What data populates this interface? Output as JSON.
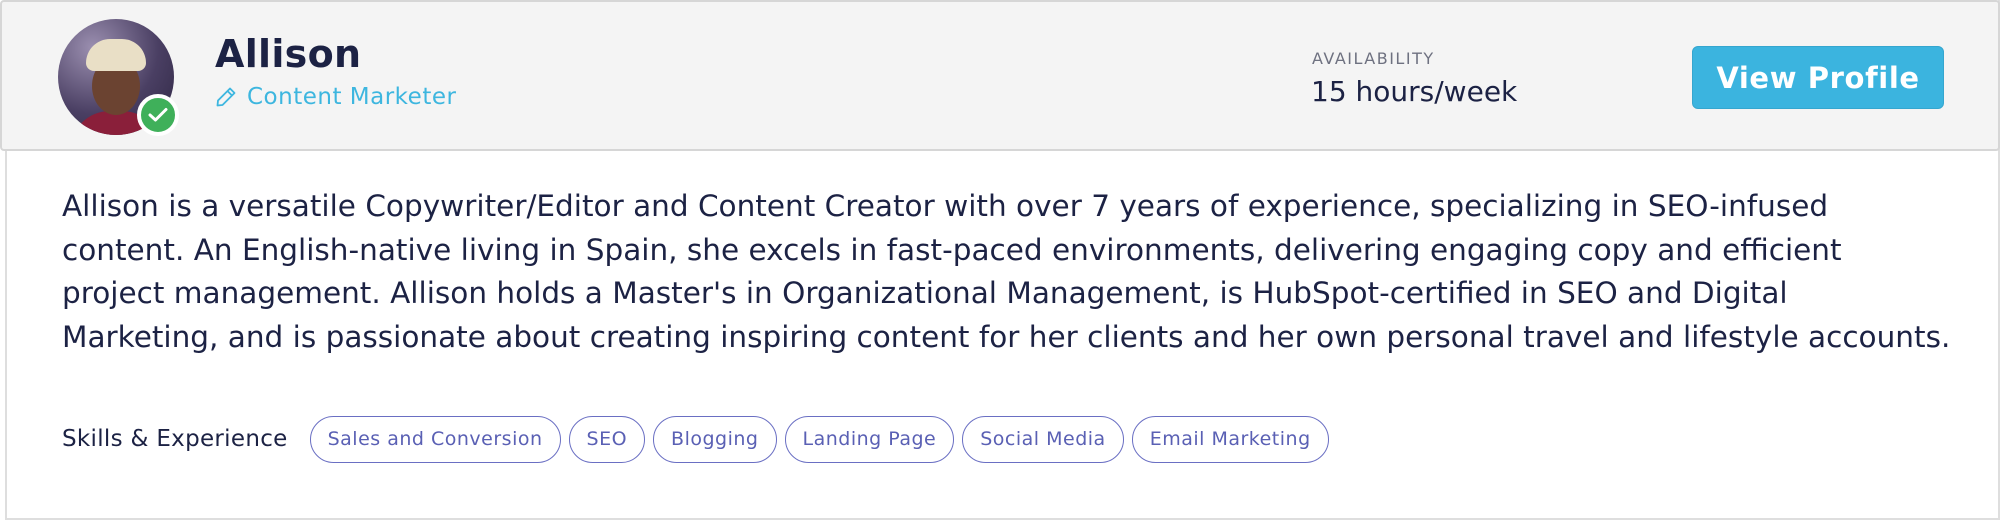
{
  "profile": {
    "name": "Allison",
    "role": "Content Marketer",
    "verified": true,
    "availability_label": "AVAILABILITY",
    "availability_value": "15 hours/week",
    "view_button_label": "View Profile"
  },
  "bio": "Allison is a versatile Copywriter/Editor and Content Creator with over 7 years of experience, specializing in SEO-infused content. An English-native living in Spain, she excels in fast-paced environments, delivering engaging copy and efficient project management. Allison holds a Master's in Organizational Management, is HubSpot-certified in SEO and Digital Marketing, and is passionate about creating inspiring content for her clients and her own personal travel and lifestyle accounts.",
  "skills": {
    "label": "Skills & Experience",
    "items": [
      "Sales and Conversion",
      "SEO",
      "Blogging",
      "Landing Page",
      "Social Media",
      "Email Marketing"
    ]
  },
  "icons": {
    "role_icon": "pencil-icon",
    "verified_icon": "checkmark-icon"
  },
  "colors": {
    "accent": "#3bb4df",
    "verified": "#3fb05a",
    "chip_border": "#6a6fc3",
    "header_bg": "#f4f4f4",
    "text": "#1c2244"
  }
}
